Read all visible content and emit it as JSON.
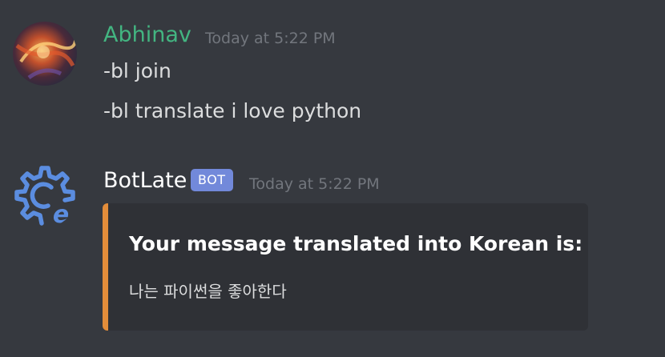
{
  "messages": [
    {
      "author": "Abhinav",
      "author_color": "#43b581",
      "timestamp": "Today at 5:22 PM",
      "lines": [
        "-bl join",
        "-bl translate i love python"
      ]
    },
    {
      "author": "BotLate",
      "author_color": "#ffffff",
      "badge": "BOT",
      "timestamp": "Today at 5:22 PM",
      "embed": {
        "accent_color": "#e38d3a",
        "title": "Your message translated into Korean is:",
        "description": "나는 파이썬을 좋아한다"
      }
    }
  ],
  "theme": {
    "background": "#36393f",
    "embed_background": "#2f3136",
    "badge_color": "#7289da",
    "timestamp_color": "#72767d"
  }
}
